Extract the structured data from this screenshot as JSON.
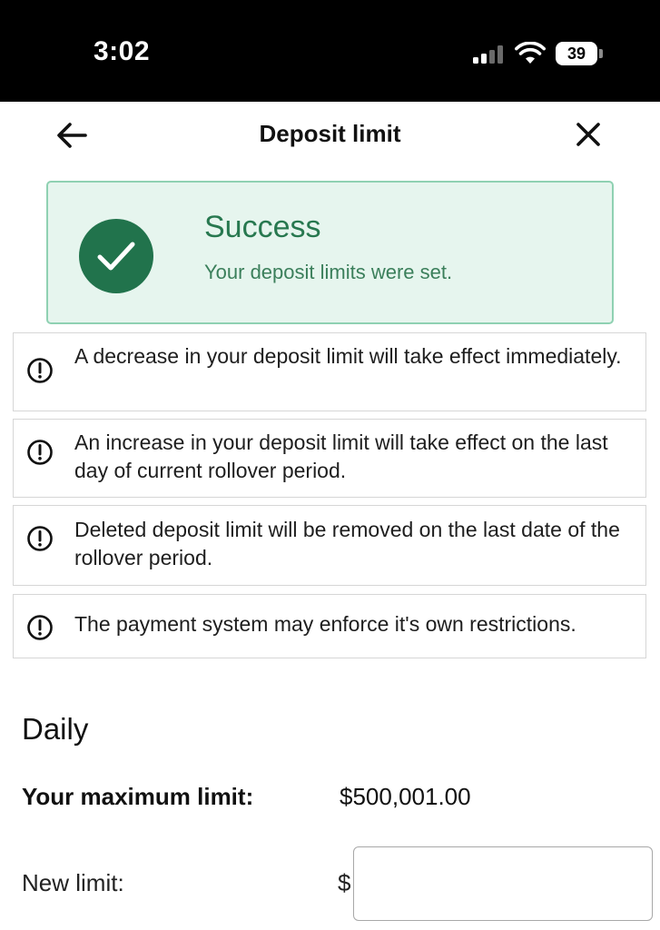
{
  "status_bar": {
    "time": "3:02",
    "battery_level": "39",
    "icons": [
      "cellular-signal-icon",
      "wifi-icon",
      "battery-icon"
    ]
  },
  "header": {
    "title": "Deposit limit",
    "back_icon": "arrow-left-icon",
    "close_icon": "close-icon"
  },
  "success": {
    "title": "Success",
    "message": "Your deposit limits were set.",
    "icon": "check-circle-icon"
  },
  "notices": [
    {
      "icon": "exclamation-circle-icon",
      "text": "A decrease in your deposit limit will take effect immediately."
    },
    {
      "icon": "exclamation-circle-icon",
      "text": "An increase in your deposit limit will take effect on the last day of current rollover period."
    },
    {
      "icon": "exclamation-circle-icon",
      "text": "Deleted deposit limit will be removed on the last date of the rollover period."
    },
    {
      "icon": "exclamation-circle-icon",
      "text": "The payment system may enforce it's own restrictions."
    }
  ],
  "daily": {
    "title": "Daily",
    "max_label": "Your maximum limit:",
    "max_value": "$500,001.00",
    "new_label": "New limit:",
    "currency": "$",
    "new_value": ""
  },
  "colors": {
    "success_bg": "#e6f5ee",
    "success_border": "#8fd1b2",
    "success_accent": "#21734c",
    "success_text": "#27784f",
    "status_bar_bg": "#000000"
  }
}
